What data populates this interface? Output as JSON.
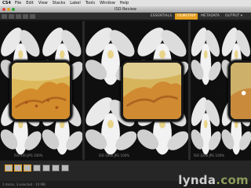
{
  "menubar": {
    "app_name": "CS4",
    "items": [
      "File",
      "Edit",
      "View",
      "Stacks",
      "Label",
      "Tools",
      "Window",
      "Help"
    ]
  },
  "window": {
    "title": "ISO Review"
  },
  "workspaces": {
    "items": [
      "ESSENTIALS",
      "FILMSTRIP",
      "METADATA",
      "OUTPUT ▾"
    ],
    "active_index": 1
  },
  "panels": [
    {
      "caption": "ISO 400.JPG 100%"
    },
    {
      "caption": "ISO 1600.JPG 100%"
    },
    {
      "caption": "ISO 3200.JPG 100%"
    }
  ],
  "statusbar": {
    "text": "3 items, 3 selected - 10 MB"
  },
  "watermark": {
    "text": "lynda",
    "suffix": ".com"
  },
  "colors": {
    "accent": "#e5a021",
    "loupe": "#d9b24a"
  }
}
